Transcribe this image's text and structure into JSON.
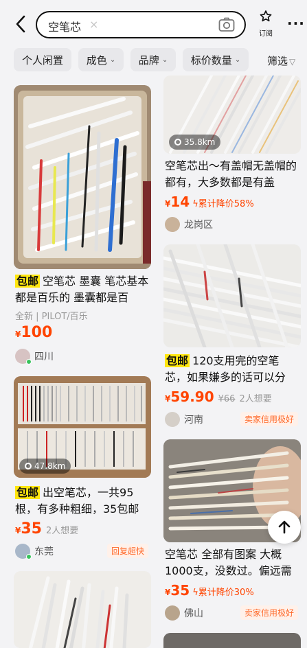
{
  "search": {
    "query": "空笔芯",
    "clear_symbol": "×"
  },
  "header": {
    "subscribe_label": "订阅",
    "more_symbol": "···"
  },
  "filters": {
    "chips": [
      "个人闲置",
      "成色",
      "品牌",
      "标价数量"
    ],
    "filter_label": "筛选"
  },
  "colors": {
    "price": "#ff4400",
    "badge": "#ffe60f"
  },
  "left_cards": [
    {
      "badge": "包邮",
      "title": "空笔芯 墨囊 笔芯基本都是百乐的 墨囊都是百",
      "meta": "全新 | PILOT/百乐",
      "price": "100",
      "seller": "四川"
    },
    {
      "distance": "47.8km",
      "badge": "包邮",
      "title": "出空笔芯，一共95根，有多种粗细，35包邮",
      "price": "35",
      "want": "2人想要",
      "seller": "东莞",
      "seller_tag": "回复超快"
    }
  ],
  "right_cards": [
    {
      "distance": "35.8km",
      "title": "空笔芯出～有盖帽无盖帽的都有，大多数都是有盖",
      "price": "14",
      "drop": "累计降价58%",
      "seller": "龙岗区"
    },
    {
      "badge": "包邮",
      "title": "120支用完的空笔芯，如果嫌多的话可以分",
      "price": "59.90",
      "orig": "¥66",
      "want": "2人想要",
      "seller": "河南",
      "seller_tag": "卖家信用极好"
    },
    {
      "title": "空笔芯 全部有图案 大概1000支，没数过。偏远需",
      "price": "35",
      "drop": "累计降价30%",
      "seller": "佛山",
      "seller_tag": "卖家信用极好"
    }
  ]
}
